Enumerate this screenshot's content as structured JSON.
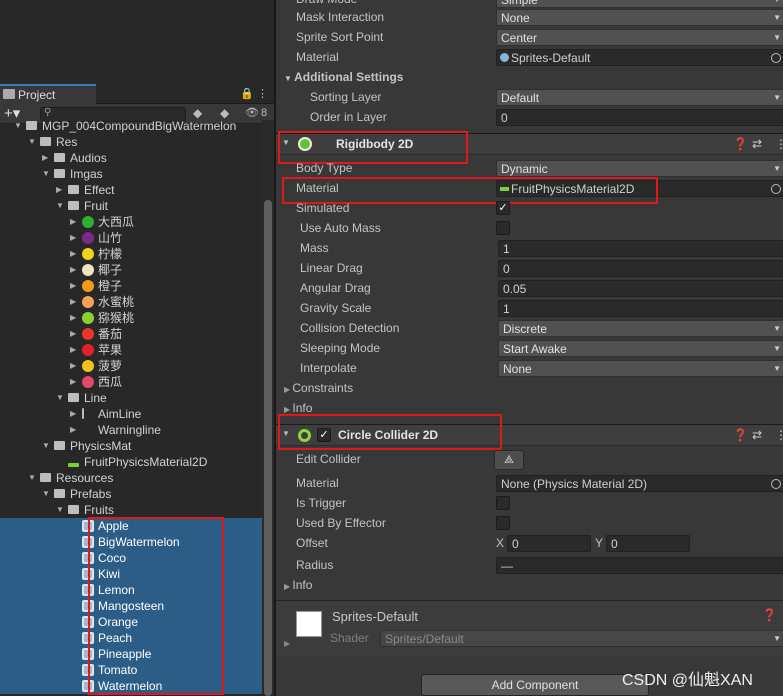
{
  "project_panel": {
    "tab_label": "Project",
    "hidden_count": "8",
    "tree": [
      {
        "label": "MGP_004CompoundBigWatermelon",
        "depth": 0,
        "arrow": "▼",
        "icon": "folder-icon"
      },
      {
        "label": "Res",
        "depth": 1,
        "arrow": "▼",
        "icon": "folder-icon"
      },
      {
        "label": "Audios",
        "depth": 2,
        "arrow": "▶",
        "icon": "folder-icon"
      },
      {
        "label": "Imgas",
        "depth": 2,
        "arrow": "▼",
        "icon": "folder-icon"
      },
      {
        "label": "Effect",
        "depth": 3,
        "arrow": "▶",
        "icon": "folder-icon"
      },
      {
        "label": "Fruit",
        "depth": 3,
        "arrow": "▼",
        "icon": "folder-icon"
      },
      {
        "label": "大西瓜",
        "depth": 4,
        "arrow": "▶",
        "icon": "fruit-icon",
        "color": "#2fae2f"
      },
      {
        "label": "山竹",
        "depth": 4,
        "arrow": "▶",
        "icon": "fruit-icon",
        "color": "#7a2a8a"
      },
      {
        "label": "柠檬",
        "depth": 4,
        "arrow": "▶",
        "icon": "fruit-icon",
        "color": "#f2d21c"
      },
      {
        "label": "椰子",
        "depth": 4,
        "arrow": "▶",
        "icon": "fruit-icon",
        "color": "#efe4c0"
      },
      {
        "label": "橙子",
        "depth": 4,
        "arrow": "▶",
        "icon": "fruit-icon",
        "color": "#f29a16"
      },
      {
        "label": "水蜜桃",
        "depth": 4,
        "arrow": "▶",
        "icon": "fruit-icon",
        "color": "#f5a35b"
      },
      {
        "label": "猕猴桃",
        "depth": 4,
        "arrow": "▶",
        "icon": "fruit-icon",
        "color": "#8ccf2a"
      },
      {
        "label": "番茄",
        "depth": 4,
        "arrow": "▶",
        "icon": "fruit-icon",
        "color": "#e8372a"
      },
      {
        "label": "苹果",
        "depth": 4,
        "arrow": "▶",
        "icon": "fruit-icon",
        "color": "#e0202a"
      },
      {
        "label": "菠萝",
        "depth": 4,
        "arrow": "▶",
        "icon": "fruit-icon",
        "color": "#f3c31c"
      },
      {
        "label": "西瓜",
        "depth": 4,
        "arrow": "▶",
        "icon": "fruit-icon",
        "color": "#e04a6a"
      },
      {
        "label": "Line",
        "depth": 3,
        "arrow": "▼",
        "icon": "folder-icon"
      },
      {
        "label": "AimLine",
        "depth": 4,
        "arrow": "▶",
        "icon": "line-icon"
      },
      {
        "label": "Warningline",
        "depth": 4,
        "arrow": "▶",
        "icon": "none"
      },
      {
        "label": "PhysicsMat",
        "depth": 2,
        "arrow": "▼",
        "icon": "folder-icon"
      },
      {
        "label": "FruitPhysicsMaterial2D",
        "depth": 3,
        "arrow": "",
        "icon": "physics-material-icon"
      },
      {
        "label": "Resources",
        "depth": 1,
        "arrow": "▼",
        "icon": "folder-icon"
      },
      {
        "label": "Prefabs",
        "depth": 2,
        "arrow": "▼",
        "icon": "folder-icon"
      },
      {
        "label": "Fruits",
        "depth": 3,
        "arrow": "▼",
        "icon": "folder-icon"
      },
      {
        "label": "Apple",
        "depth": 4,
        "arrow": "",
        "icon": "prefab-icon",
        "selected": true
      },
      {
        "label": "BigWatermelon",
        "depth": 4,
        "arrow": "",
        "icon": "prefab-icon",
        "selected": true
      },
      {
        "label": "Coco",
        "depth": 4,
        "arrow": "",
        "icon": "prefab-icon",
        "selected": true
      },
      {
        "label": "Kiwi",
        "depth": 4,
        "arrow": "",
        "icon": "prefab-icon",
        "selected": true
      },
      {
        "label": "Lemon",
        "depth": 4,
        "arrow": "",
        "icon": "prefab-icon",
        "selected": true
      },
      {
        "label": "Mangosteen",
        "depth": 4,
        "arrow": "",
        "icon": "prefab-icon",
        "selected": true
      },
      {
        "label": "Orange",
        "depth": 4,
        "arrow": "",
        "icon": "prefab-icon",
        "selected": true
      },
      {
        "label": "Peach",
        "depth": 4,
        "arrow": "",
        "icon": "prefab-icon",
        "selected": true
      },
      {
        "label": "Pineapple",
        "depth": 4,
        "arrow": "",
        "icon": "prefab-icon",
        "selected": true
      },
      {
        "label": "Tomato",
        "depth": 4,
        "arrow": "",
        "icon": "prefab-icon",
        "selected": true
      },
      {
        "label": "Watermelon",
        "depth": 4,
        "arrow": "",
        "icon": "prefab-icon",
        "selected": true
      }
    ]
  },
  "inspector": {
    "sprite_renderer": {
      "draw_mode_label": "Draw Mode",
      "draw_mode_value": "Simple",
      "mask_label": "Mask Interaction",
      "mask_value": "None",
      "sort_point_label": "Sprite Sort Point",
      "sort_point_value": "Center",
      "material_label": "Material",
      "material_value": "Sprites-Default",
      "additional_settings": "Additional Settings",
      "sorting_layer_label": "Sorting Layer",
      "sorting_layer_value": "Default",
      "order_label": "Order in Layer",
      "order_value": "0"
    },
    "rigidbody": {
      "title": "Rigidbody 2D",
      "body_type_label": "Body Type",
      "body_type_value": "Dynamic",
      "material_label": "Material",
      "material_value": "FruitPhysicsMaterial2D",
      "simulated_label": "Simulated",
      "simulated": true,
      "auto_mass_label": "Use Auto Mass",
      "mass_label": "Mass",
      "mass_value": "1",
      "linear_drag_label": "Linear Drag",
      "linear_drag_value": "0",
      "angular_drag_label": "Angular Drag",
      "angular_drag_value": "0.05",
      "gravity_label": "Gravity Scale",
      "gravity_value": "1",
      "collision_label": "Collision Detection",
      "collision_value": "Discrete",
      "sleeping_label": "Sleeping Mode",
      "sleeping_value": "Start Awake",
      "interpolate_label": "Interpolate",
      "interpolate_value": "None",
      "constraints_label": "Constraints",
      "info_label": "Info"
    },
    "circle_collider": {
      "title": "Circle Collider 2D",
      "edit_label": "Edit Collider",
      "material_label": "Material",
      "material_value": "None (Physics Material 2D)",
      "trigger_label": "Is Trigger",
      "effector_label": "Used By Effector",
      "offset_label": "Offset",
      "offset_x_label": "X",
      "offset_x": "0",
      "offset_y_label": "Y",
      "offset_y": "0",
      "radius_label": "Radius",
      "radius_value": "—",
      "info_label": "Info"
    },
    "material_preview": {
      "name": "Sprites-Default",
      "shader_label": "Shader",
      "shader_value": "Sprites/Default"
    },
    "add_component": "Add Component"
  },
  "watermark": "CSDN @仙魁XAN",
  "colors": {
    "highlight": "#e0181a",
    "selection": "#2c5d87"
  }
}
